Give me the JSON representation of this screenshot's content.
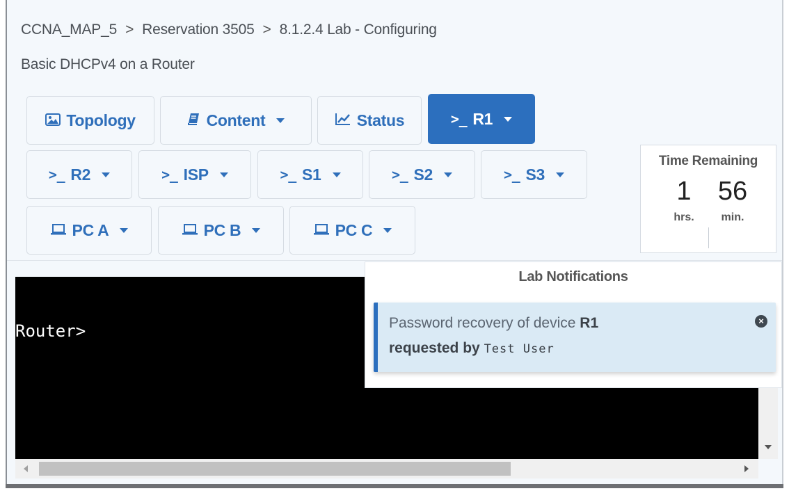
{
  "breadcrumb": {
    "items": [
      "CCNA_MAP_5",
      "Reservation 3505",
      "8.1.2.4 Lab - Configuring"
    ],
    "continuation": "Basic DHCPv4 on a Router",
    "separator": ">"
  },
  "toolbar": {
    "topology": "Topology",
    "content": "Content",
    "status": "Status",
    "r1": "R1",
    "r2": "R2",
    "isp": "ISP",
    "s1": "S1",
    "s2": "S2",
    "s3": "S3",
    "pca": "PC A",
    "pcb": "PC B",
    "pcc": "PC C",
    "terminal_glyph": ">_"
  },
  "timer": {
    "title": "Time Remaining",
    "hours": "1",
    "minutes": "56",
    "hours_unit": "hrs.",
    "minutes_unit": "min."
  },
  "terminal": {
    "prompt": "Router>"
  },
  "notifications": {
    "title": "Lab Notifications",
    "message_prefix": "Password recovery of device",
    "device": "R1",
    "requested_by_label": "requested by",
    "user": "Test User"
  },
  "colors": {
    "accent": "#2c6fbe",
    "link_text": "#2f6fba",
    "notification_bg": "#daeaf5",
    "terminal_bg": "#000000"
  },
  "icons": [
    "image-icon",
    "book-icon",
    "chart-line-icon",
    "terminal-icon",
    "laptop-icon",
    "close-circle-icon"
  ]
}
